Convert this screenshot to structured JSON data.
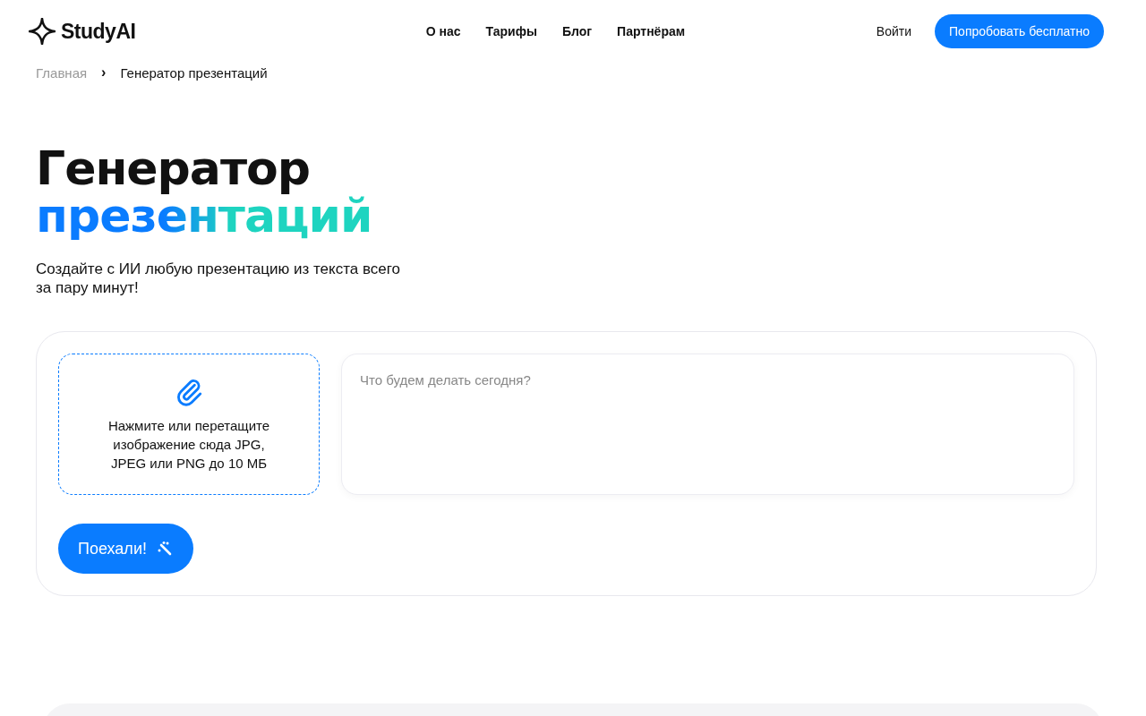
{
  "header": {
    "logo": "StudyAI",
    "nav": [
      "О нас",
      "Тарифы",
      "Блог",
      "Партнёрам"
    ],
    "login": "Войти",
    "cta": "Попробовать бесплатно"
  },
  "breadcrumbs": [
    {
      "label": "Главная",
      "current": false
    },
    {
      "label": "Генератор презентаций",
      "current": true
    }
  ],
  "breadcrumb_separator": "›",
  "hero": {
    "title_line_1": "Генератор",
    "title_line_2": "презентаций",
    "subtitle": "Создайте с ИИ любую презентацию из текста всего за пару минут!"
  },
  "form": {
    "upload_hint": "Нажмите или перетащите изображение сюда JPG, JPEG или PNG до 10 МБ",
    "prompt_placeholder": "Что будем делать сегодня?",
    "submit": "Поехали!"
  }
}
